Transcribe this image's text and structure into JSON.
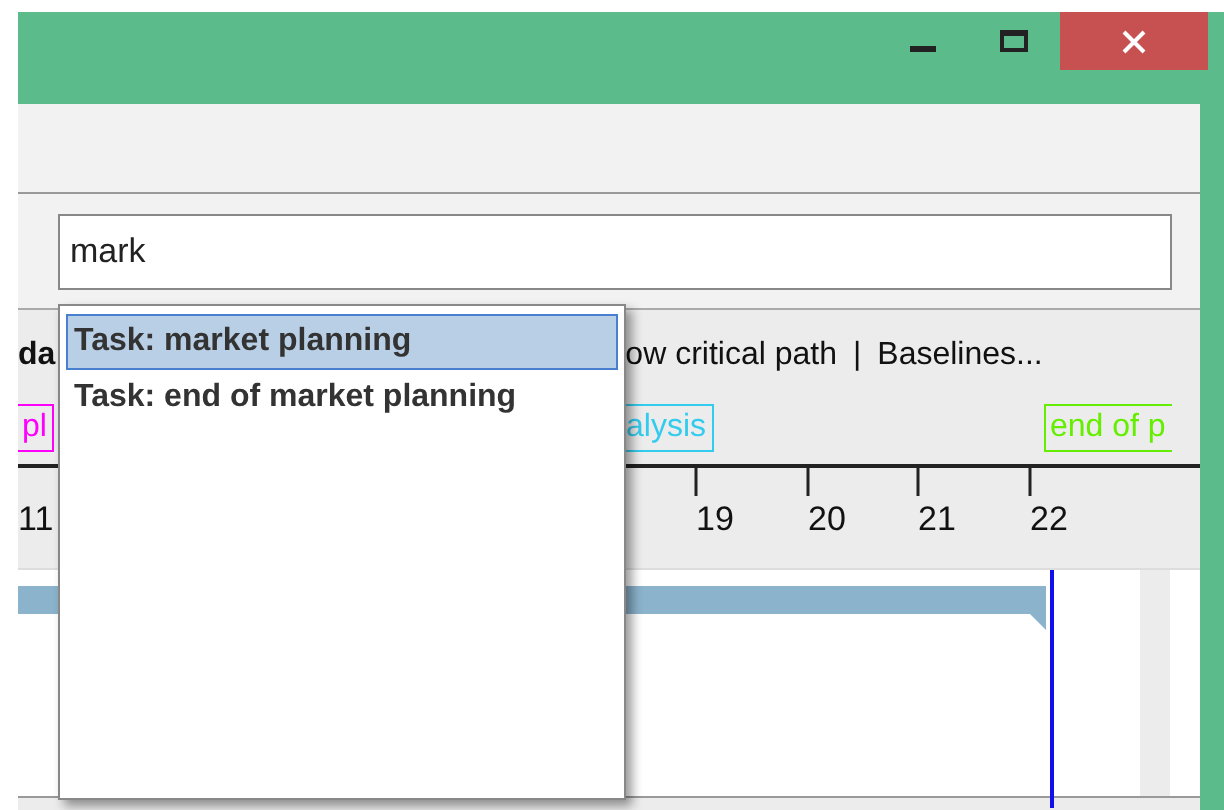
{
  "search": {
    "value": "mark"
  },
  "suggestions": [
    {
      "label": "Task: market planning",
      "selected": true
    },
    {
      "label": "Task: end of market planning",
      "selected": false
    }
  ],
  "toolbar": {
    "lead": "da",
    "items": [
      "ow critical path",
      "Baselines..."
    ],
    "separator": "|"
  },
  "milestones": [
    {
      "label": "pl",
      "color": "#ff00ff"
    },
    {
      "label": "alysis",
      "color": "#33ccee"
    },
    {
      "label": "end of p",
      "color": "#66ee00"
    }
  ],
  "timeline": {
    "days": [
      "11",
      "19",
      "20",
      "21",
      "22"
    ]
  }
}
